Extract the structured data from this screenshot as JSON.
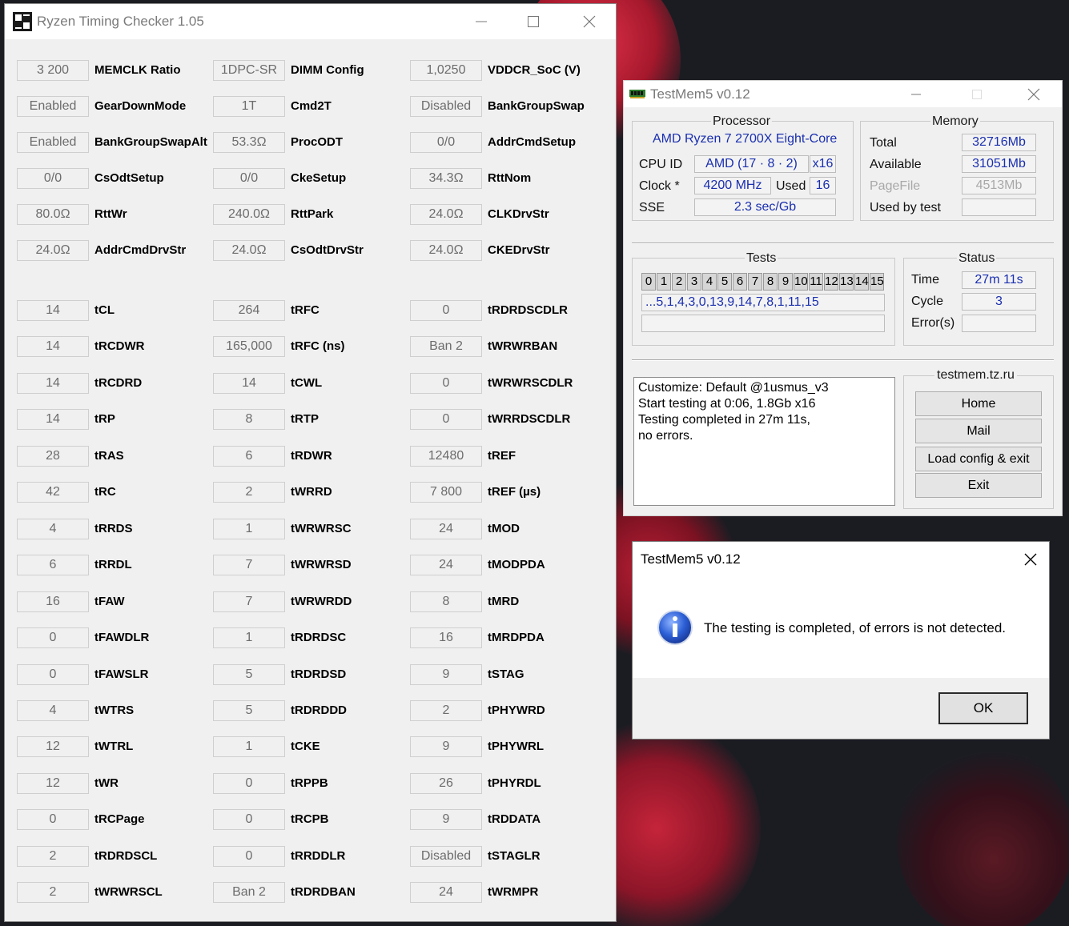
{
  "rtc": {
    "title": "Ryzen Timing Checker 1.05",
    "top_rows": [
      [
        [
          "3 200",
          "MEMCLK Ratio"
        ],
        [
          "1DPC-SR",
          "DIMM Config"
        ],
        [
          "1,0250",
          "VDDCR_SoC (V)"
        ]
      ],
      [
        [
          "Enabled",
          "GearDownMode"
        ],
        [
          "1T",
          "Cmd2T"
        ],
        [
          "Disabled",
          "BankGroupSwap"
        ]
      ],
      [
        [
          "Enabled",
          "BankGroupSwapAlt"
        ],
        [
          "53.3Ω",
          "ProcODT"
        ],
        [
          "0/0",
          "AddrCmdSetup"
        ]
      ],
      [
        [
          "0/0",
          "CsOdtSetup"
        ],
        [
          "0/0",
          "CkeSetup"
        ],
        [
          "34.3Ω",
          "RttNom"
        ]
      ],
      [
        [
          "80.0Ω",
          "RttWr"
        ],
        [
          "240.0Ω",
          "RttPark"
        ],
        [
          "24.0Ω",
          "CLKDrvStr"
        ]
      ],
      [
        [
          "24.0Ω",
          "AddrCmdDrvStr"
        ],
        [
          "24.0Ω",
          "CsOdtDrvStr"
        ],
        [
          "24.0Ω",
          "CKEDrvStr"
        ]
      ]
    ],
    "timing_rows": [
      [
        [
          "14",
          "tCL"
        ],
        [
          "264",
          "tRFC"
        ],
        [
          "0",
          "tRDRDSCDLR"
        ]
      ],
      [
        [
          "14",
          "tRCDWR"
        ],
        [
          "165,000",
          "tRFC (ns)"
        ],
        [
          "Ban 2",
          "tWRWRBAN"
        ]
      ],
      [
        [
          "14",
          "tRCDRD"
        ],
        [
          "14",
          "tCWL"
        ],
        [
          "0",
          "tWRWRSCDLR"
        ]
      ],
      [
        [
          "14",
          "tRP"
        ],
        [
          "8",
          "tRTP"
        ],
        [
          "0",
          "tWRRDSCDLR"
        ]
      ],
      [
        [
          "28",
          "tRAS"
        ],
        [
          "6",
          "tRDWR"
        ],
        [
          "12480",
          "tREF"
        ]
      ],
      [
        [
          "42",
          "tRC"
        ],
        [
          "2",
          "tWRRD"
        ],
        [
          "7 800",
          "tREF (µs)"
        ]
      ],
      [
        [
          "4",
          "tRRDS"
        ],
        [
          "1",
          "tWRWRSC"
        ],
        [
          "24",
          "tMOD"
        ]
      ],
      [
        [
          "6",
          "tRRDL"
        ],
        [
          "7",
          "tWRWRSD"
        ],
        [
          "24",
          "tMODPDA"
        ]
      ],
      [
        [
          "16",
          "tFAW"
        ],
        [
          "7",
          "tWRWRDD"
        ],
        [
          "8",
          "tMRD"
        ]
      ],
      [
        [
          "0",
          "tFAWDLR"
        ],
        [
          "1",
          "tRDRDSC"
        ],
        [
          "16",
          "tMRDPDA"
        ]
      ],
      [
        [
          "0",
          "tFAWSLR"
        ],
        [
          "5",
          "tRDRDSD"
        ],
        [
          "9",
          "tSTAG"
        ]
      ],
      [
        [
          "4",
          "tWTRS"
        ],
        [
          "5",
          "tRDRDDD"
        ],
        [
          "2",
          "tPHYWRD"
        ]
      ],
      [
        [
          "12",
          "tWTRL"
        ],
        [
          "1",
          "tCKE"
        ],
        [
          "9",
          "tPHYWRL"
        ]
      ],
      [
        [
          "12",
          "tWR"
        ],
        [
          "0",
          "tRPPB"
        ],
        [
          "26",
          "tPHYRDL"
        ]
      ],
      [
        [
          "0",
          "tRCPage"
        ],
        [
          "0",
          "tRCPB"
        ],
        [
          "9",
          "tRDDATA"
        ]
      ],
      [
        [
          "2",
          "tRDRDSCL"
        ],
        [
          "0",
          "tRRDDLR"
        ],
        [
          "Disabled",
          "tSTAGLR"
        ]
      ],
      [
        [
          "2",
          "tWRWRSCL"
        ],
        [
          "Ban 2",
          "tRDRDBAN"
        ],
        [
          "24",
          "tWRMPR"
        ]
      ]
    ]
  },
  "tm": {
    "title": "TestMem5 v0.12",
    "processor": {
      "title": "Processor",
      "name": "AMD Ryzen 7 2700X Eight-Core",
      "cpu_id_label": "CPU ID",
      "cpu_id": "AMD  (17 · 8 · 2)",
      "threads": "x16",
      "clock_label": "Clock *",
      "clock": "4200 MHz",
      "used_label": "Used",
      "used": "16",
      "sse_label": "SSE",
      "sse": "2.3 sec/Gb"
    },
    "memory": {
      "title": "Memory",
      "total_label": "Total",
      "total": "32716Mb",
      "available_label": "Available",
      "available": "31051Mb",
      "pagefile_label": "PageFile",
      "pagefile": "4513Mb",
      "usedbytest_label": "Used by test",
      "usedbytest": ""
    },
    "tests": {
      "title": "Tests",
      "numbers": [
        "0",
        "1",
        "2",
        "3",
        "4",
        "5",
        "6",
        "7",
        "8",
        "9",
        "10",
        "11",
        "12",
        "13",
        "14",
        "15"
      ],
      "sequence": "...5,1,4,3,0,13,9,14,7,8,1,11,15",
      "progress": ""
    },
    "status": {
      "title": "Status",
      "time_label": "Time",
      "time": "27m 11s",
      "cycle_label": "Cycle",
      "cycle": "3",
      "errors_label": "Error(s)",
      "errors": ""
    },
    "log": [
      "Customize: Default @1usmus_v3",
      "Start testing at 0:06, 1.8Gb x16",
      "Testing completed in 27m 11s,",
      "no errors."
    ],
    "site": {
      "title": "testmem.tz.ru",
      "buttons": [
        "Home",
        "Mail",
        "Load config & exit",
        "Exit"
      ]
    }
  },
  "dialog": {
    "title": "TestMem5 v0.12",
    "message": "The testing is completed, of errors is not detected.",
    "ok": "OK"
  }
}
